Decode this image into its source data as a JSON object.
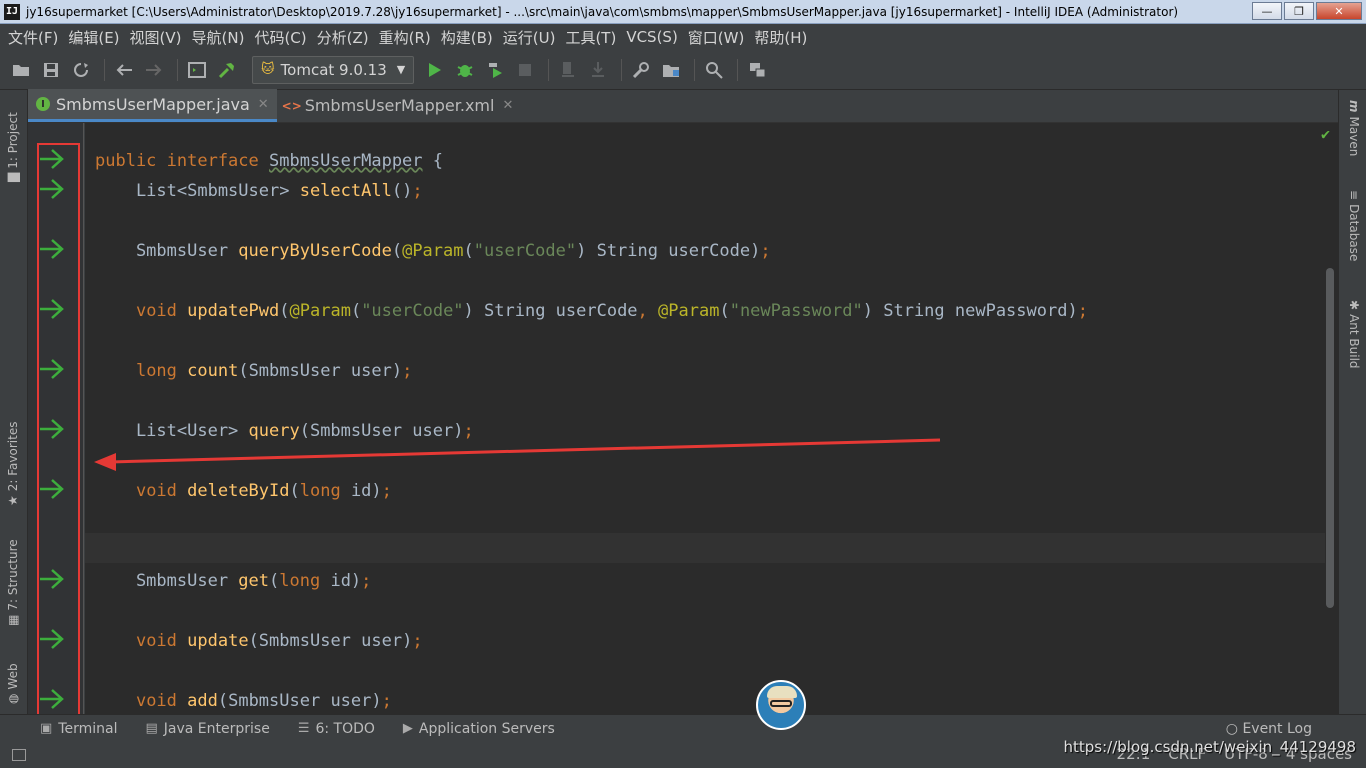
{
  "window": {
    "title": "jy16supermarket [C:\\Users\\Administrator\\Desktop\\2019.7.28\\jy16supermarket] - ...\\src\\main\\java\\com\\smbms\\mapper\\SmbmsUserMapper.java [jy16supermarket] - IntelliJ IDEA (Administrator)",
    "app_icon": "IJ",
    "minimize": "—",
    "maximize": "❐",
    "close": "✕"
  },
  "menu": [
    "文件(F)",
    "编辑(E)",
    "视图(V)",
    "导航(N)",
    "代码(C)",
    "分析(Z)",
    "重构(R)",
    "构建(B)",
    "运行(U)",
    "工具(T)",
    "VCS(S)",
    "窗口(W)",
    "帮助(H)"
  ],
  "toolbar": {
    "run_config": "Tomcat 9.0.13"
  },
  "tabs": [
    {
      "label": "SmbmsUserMapper.java",
      "icon": "interface-icon",
      "active": true
    },
    {
      "label": "SmbmsUserMapper.xml",
      "icon": "xml-file-icon",
      "active": false
    }
  ],
  "left_tools": {
    "project": "1: Project",
    "favorites": "2: Favorites",
    "structure": "7: Structure",
    "web": "Web"
  },
  "right_tools": {
    "maven": "Maven",
    "database": "Database",
    "ant": "Ant Build"
  },
  "code": {
    "l1": {
      "a": "public interface ",
      "b": "SmbmsUserMapper",
      "c": " {"
    },
    "l2": {
      "a": "    List<SmbmsUser> ",
      "b": "selectAll",
      "c": "()",
      "d": ";"
    },
    "l3": {
      "a": "    SmbmsUser ",
      "b": "queryByUserCode",
      "c": "(",
      "d": "@Param",
      "e": "(",
      "f": "\"userCode\"",
      "g": ") String userCode)",
      "h": ";"
    },
    "l4": {
      "a": "    ",
      "b": "void ",
      "c": "updatePwd",
      "d": "(",
      "e": "@Param",
      "f": "(",
      "g": "\"userCode\"",
      "h": ") String userCode",
      "i": ", ",
      "j": "@Param",
      "k": "(",
      "l": "\"newPassword\"",
      "m": ") String newPassword)",
      "n": ";"
    },
    "l5": {
      "a": "    ",
      "b": "long ",
      "c": "count",
      "d": "(SmbmsUser user)",
      "e": ";"
    },
    "l6": {
      "a": "    List<User> ",
      "b": "query",
      "c": "(SmbmsUser user)",
      "d": ";"
    },
    "l7": {
      "a": "    ",
      "b": "void ",
      "c": "deleteById",
      "d": "(",
      "e": "long ",
      "f": "id)",
      "g": ";"
    },
    "l8": {
      "a": "    SmbmsUser ",
      "b": "get",
      "c": "(",
      "d": "long ",
      "e": "id)",
      "f": ";"
    },
    "l9": {
      "a": "    ",
      "b": "void ",
      "c": "update",
      "d": "(SmbmsUser user)",
      "e": ";"
    },
    "l10": {
      "a": "    ",
      "b": "void ",
      "c": "add",
      "d": "(SmbmsUser user)",
      "e": ";"
    }
  },
  "bottom_tools": [
    {
      "label": "Terminal",
      "icon": "terminal-icon"
    },
    {
      "label": "Java Enterprise",
      "icon": "java-enterprise-icon"
    },
    {
      "label": "6: TODO",
      "icon": "todo-icon"
    },
    {
      "label": "Application Servers",
      "icon": "app-servers-icon"
    }
  ],
  "event_log": "Event Log",
  "status": {
    "position": "22:1",
    "line_sep": "CRLF",
    "encoding": "UTF-8",
    "indent": "4 spaces"
  },
  "watermark": "https://blog.csdn.net/weixin_44129498",
  "colors": {
    "keyword": "#cc7832",
    "method": "#ffc66d",
    "annotation": "#bbb529",
    "string": "#6a8759",
    "gutter_arrow": "#3dae3d",
    "highlight_box": "#e53935"
  }
}
